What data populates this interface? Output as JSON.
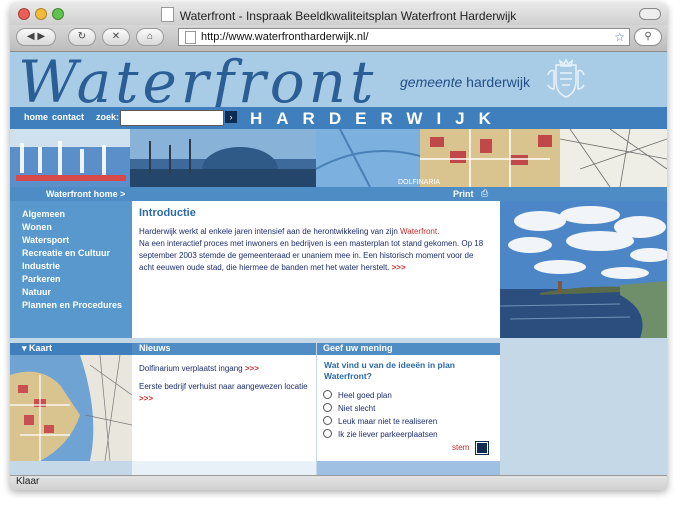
{
  "browser": {
    "window_title": "Waterfront - Inspraak Beeldkwaliteitsplan Waterfront Harderwijk",
    "url": "http://www.waterfrontharderwijk.nl/",
    "status": "Klaar",
    "nav_icons": [
      "back-icon",
      "forward-icon",
      "reload-icon",
      "stop-icon",
      "home-icon",
      "page-icon",
      "bookmark-star-icon",
      "search-icon"
    ]
  },
  "site": {
    "logo": "Waterfront",
    "gemeente_prefix": "gemeente",
    "gemeente_name": "harderwijk",
    "nav": {
      "home": "home",
      "contact": "contact",
      "search_label": "zoek:",
      "search_value": ""
    },
    "city_banner": "HARDERWIJK",
    "banner_caption": "DOLFINARIA",
    "home_link": "Waterfront home >",
    "print": "Print",
    "sidebar": [
      "Algemeen",
      "Wonen",
      "Watersport",
      "Recreatie en Cultuur",
      "Industrie",
      "Parkeren",
      "Natuur",
      "Plannen en Procedures"
    ],
    "intro": {
      "heading": "Introductie",
      "p1": "Harderwijk werkt al enkele jaren intensief aan de herontwikkeling van zijn ",
      "p1_link": "Waterfront",
      "p1_end": ".",
      "p2": "Na een interactief proces met inwoners en bedrijven is een masterplan tot stand gekomen. Op 18 september 2003 stemde de gemeenteraad er unaniem mee in. Een historisch moment voor de acht eeuwen oude stad, die hiermee de banden met het water herstelt.",
      "more": ">>>"
    },
    "kaart": "Kaart",
    "nieuws": {
      "heading": "Nieuws",
      "items": [
        {
          "text": "Dolfinarium verplaatst ingang",
          "more": ">>>"
        },
        {
          "text": "Eerste bedrijf verhuist naar aangewezen locatie",
          "more": ">>>"
        }
      ]
    },
    "poll": {
      "heading": "Geef uw mening",
      "question": "Wat vind u van de ideeën in plan Waterfront?",
      "options": [
        "Heel goed plan",
        "Niet slecht",
        "Leuk maar niet te realiseren",
        "Ik zie liever parkeerplaatsen"
      ],
      "submit": "stem"
    }
  },
  "colors": {
    "header_bg": "#a9cce6",
    "nav_blue": "#3f7fbd",
    "sidebar_blue": "#5898cc",
    "logo_blue": "#2a5e94",
    "link_red": "#cc2b2b",
    "text_navy": "#1e2e6e",
    "heading_blue": "#2b6aa6"
  }
}
